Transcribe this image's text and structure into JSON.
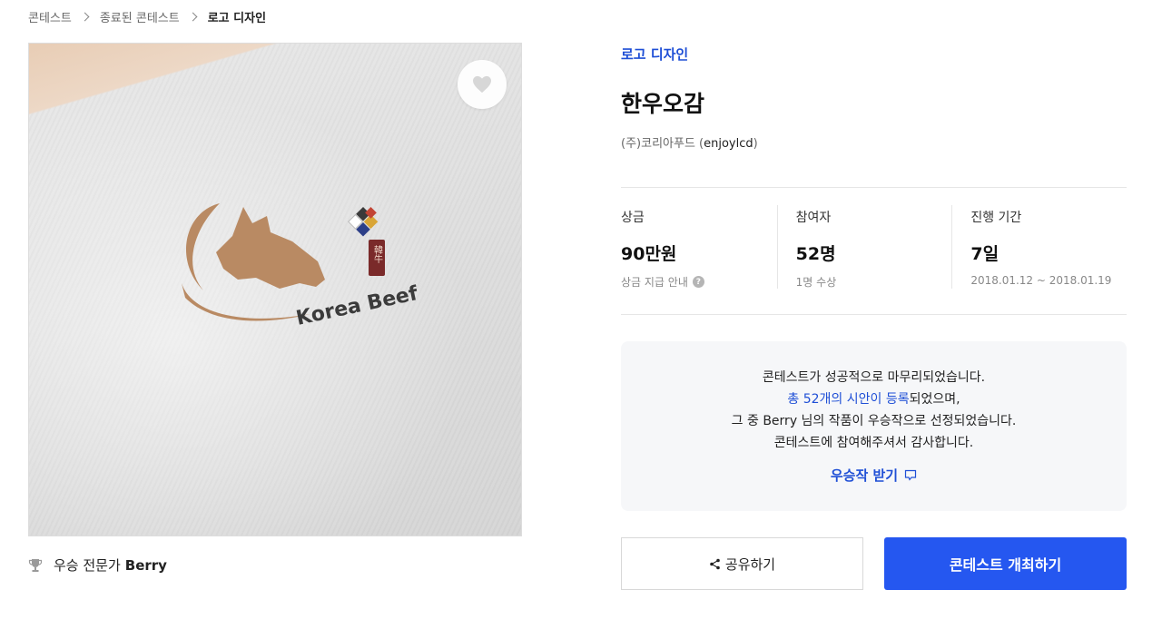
{
  "breadcrumb": {
    "items": [
      "콘테스트",
      "종료된 콘테스트",
      "로고 디자인"
    ]
  },
  "hero": {
    "logo_text": "Korea Beef",
    "seal_text": "韓牛",
    "icons": {
      "favorite": "heart-icon"
    }
  },
  "winner": {
    "prefix": "우승 전문가",
    "name": "Berry",
    "icon": "trophy-icon"
  },
  "contest": {
    "category": "로고 디자인",
    "title": "한우오감",
    "host_company": "(주)코리아푸드",
    "host_id_open": " (",
    "host_id": "enjoylcd",
    "host_id_close": ")"
  },
  "stats": [
    {
      "label": "상금",
      "value": "90만원",
      "sub": "상금 지급 안내"
    },
    {
      "label": "참여자",
      "value": "52명",
      "sub": "1명 수상"
    },
    {
      "label": "진행 기간",
      "value": "7일",
      "sub": "2018.01.12 ~ 2018.01.19"
    }
  ],
  "notice": {
    "line1": "콘테스트가 성공적으로 마무리되었습니다.",
    "line2_link": "총 52개의 시안이 등록",
    "line2_rest": "되었으며,",
    "line3": "그 중 Berry 님의 작품이 우승작으로 선정되었습니다.",
    "line4": "콘테스트에 참여해주셔서 감사합니다.",
    "cta": "우승작 받기"
  },
  "actions": {
    "share": "공유하기",
    "host": "콘테스트 개최하기"
  },
  "colors": {
    "accent": "#1f4fd6",
    "primary_button": "#2557f0",
    "notice_bg": "#f6f7f9",
    "logo_brown": "#b98a63"
  }
}
